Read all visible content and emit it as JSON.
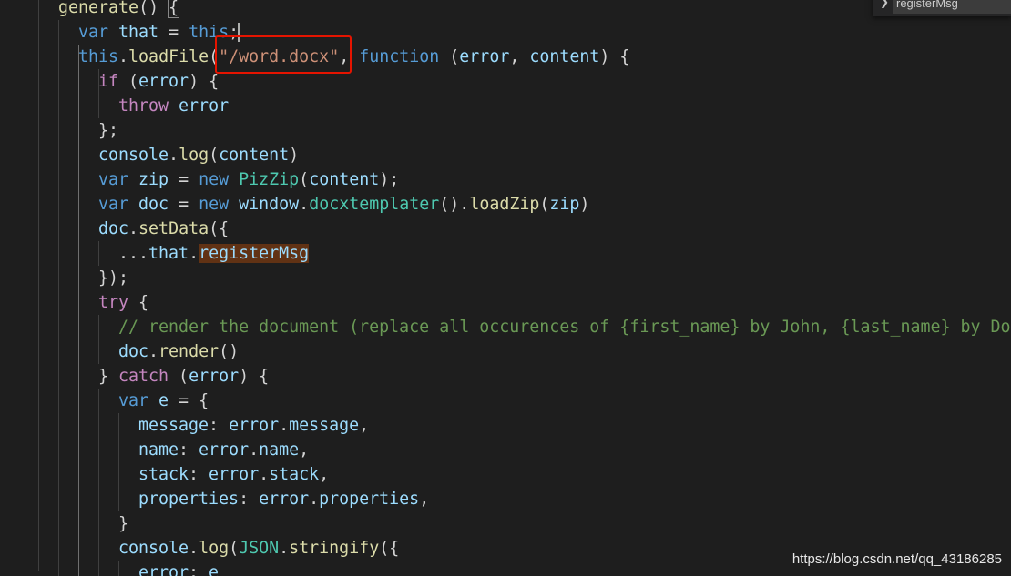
{
  "code_lines": [
    [
      {
        "c": "f",
        "t": "generate"
      },
      {
        "c": "p",
        "t": "() "
      },
      {
        "c": "p bm",
        "t": "{"
      }
    ],
    [
      {
        "c": "k",
        "t": "var "
      },
      {
        "c": "v",
        "t": "that"
      },
      {
        "c": "p",
        "t": " = "
      },
      {
        "c": "k",
        "t": "this"
      },
      {
        "c": "p",
        "t": ";"
      }
    ],
    [
      {
        "c": "k",
        "t": "this"
      },
      {
        "c": "p",
        "t": "."
      },
      {
        "c": "f",
        "t": "loadFile"
      },
      {
        "c": "p",
        "t": "("
      },
      {
        "c": "s",
        "t": "\"/word.docx\""
      },
      {
        "c": "p",
        "t": ", "
      },
      {
        "c": "k",
        "t": "function"
      },
      {
        "c": "p",
        "t": " ("
      },
      {
        "c": "v",
        "t": "error"
      },
      {
        "c": "p",
        "t": ", "
      },
      {
        "c": "v",
        "t": "content"
      },
      {
        "c": "p",
        "t": ") {"
      }
    ],
    [
      {
        "c": "c",
        "t": "if"
      },
      {
        "c": "p",
        "t": " ("
      },
      {
        "c": "v",
        "t": "error"
      },
      {
        "c": "p",
        "t": ") {"
      }
    ],
    [
      {
        "c": "c",
        "t": "throw "
      },
      {
        "c": "v",
        "t": "error"
      }
    ],
    [
      {
        "c": "p",
        "t": "};"
      }
    ],
    [
      {
        "c": "v",
        "t": "console"
      },
      {
        "c": "p",
        "t": "."
      },
      {
        "c": "f",
        "t": "log"
      },
      {
        "c": "p",
        "t": "("
      },
      {
        "c": "v",
        "t": "content"
      },
      {
        "c": "p",
        "t": ")"
      }
    ],
    [
      {
        "c": "k",
        "t": "var "
      },
      {
        "c": "v",
        "t": "zip"
      },
      {
        "c": "p",
        "t": " = "
      },
      {
        "c": "k",
        "t": "new "
      },
      {
        "c": "t",
        "t": "PizZip"
      },
      {
        "c": "p",
        "t": "("
      },
      {
        "c": "v",
        "t": "content"
      },
      {
        "c": "p",
        "t": ");"
      }
    ],
    [
      {
        "c": "k",
        "t": "var "
      },
      {
        "c": "v",
        "t": "doc"
      },
      {
        "c": "p",
        "t": " = "
      },
      {
        "c": "k",
        "t": "new "
      },
      {
        "c": "v",
        "t": "window"
      },
      {
        "c": "p",
        "t": "."
      },
      {
        "c": "t",
        "t": "docxtemplater"
      },
      {
        "c": "p",
        "t": "()."
      },
      {
        "c": "f",
        "t": "loadZip"
      },
      {
        "c": "p",
        "t": "("
      },
      {
        "c": "v",
        "t": "zip"
      },
      {
        "c": "p",
        "t": ")"
      }
    ],
    [
      {
        "c": "v",
        "t": "doc"
      },
      {
        "c": "p",
        "t": "."
      },
      {
        "c": "f",
        "t": "setData"
      },
      {
        "c": "p",
        "t": "({"
      }
    ],
    [
      {
        "c": "p",
        "t": "..."
      },
      {
        "c": "v",
        "t": "that"
      },
      {
        "c": "p",
        "t": "."
      },
      {
        "c": "v hl",
        "t": "registerMsg"
      }
    ],
    [
      {
        "c": "p",
        "t": "});"
      }
    ],
    [
      {
        "c": "c",
        "t": "try"
      },
      {
        "c": "p",
        "t": " {"
      }
    ],
    [
      {
        "c": "m",
        "t": "// render the document (replace all occurences of {first_name} by John, {last_name} by Doe, ...)"
      }
    ],
    [
      {
        "c": "v",
        "t": "doc"
      },
      {
        "c": "p",
        "t": "."
      },
      {
        "c": "f",
        "t": "render"
      },
      {
        "c": "p",
        "t": "()"
      }
    ],
    [
      {
        "c": "p",
        "t": "} "
      },
      {
        "c": "c",
        "t": "catch"
      },
      {
        "c": "p",
        "t": " ("
      },
      {
        "c": "v",
        "t": "error"
      },
      {
        "c": "p",
        "t": ") {"
      }
    ],
    [
      {
        "c": "k",
        "t": "var "
      },
      {
        "c": "v",
        "t": "e"
      },
      {
        "c": "p",
        "t": " = {"
      }
    ],
    [
      {
        "c": "v",
        "t": "message"
      },
      {
        "c": "p",
        "t": ": "
      },
      {
        "c": "v",
        "t": "error"
      },
      {
        "c": "p",
        "t": "."
      },
      {
        "c": "v",
        "t": "message"
      },
      {
        "c": "p",
        "t": ","
      }
    ],
    [
      {
        "c": "v",
        "t": "name"
      },
      {
        "c": "p",
        "t": ": "
      },
      {
        "c": "v",
        "t": "error"
      },
      {
        "c": "p",
        "t": "."
      },
      {
        "c": "v",
        "t": "name"
      },
      {
        "c": "p",
        "t": ","
      }
    ],
    [
      {
        "c": "v",
        "t": "stack"
      },
      {
        "c": "p",
        "t": ": "
      },
      {
        "c": "v",
        "t": "error"
      },
      {
        "c": "p",
        "t": "."
      },
      {
        "c": "v",
        "t": "stack"
      },
      {
        "c": "p",
        "t": ","
      }
    ],
    [
      {
        "c": "v",
        "t": "properties"
      },
      {
        "c": "p",
        "t": ": "
      },
      {
        "c": "v",
        "t": "error"
      },
      {
        "c": "p",
        "t": "."
      },
      {
        "c": "v",
        "t": "properties"
      },
      {
        "c": "p",
        "t": ","
      }
    ],
    [
      {
        "c": "p",
        "t": "}"
      }
    ],
    [
      {
        "c": "v",
        "t": "console"
      },
      {
        "c": "p",
        "t": "."
      },
      {
        "c": "f",
        "t": "log"
      },
      {
        "c": "p",
        "t": "("
      },
      {
        "c": "t",
        "t": "JSON"
      },
      {
        "c": "p",
        "t": "."
      },
      {
        "c": "f",
        "t": "stringify"
      },
      {
        "c": "p",
        "t": "({"
      }
    ],
    [
      {
        "c": "v",
        "t": "error"
      },
      {
        "c": "p",
        "t": ": "
      },
      {
        "c": "v",
        "t": "e"
      }
    ]
  ],
  "find_widget": {
    "query": "registerMsg",
    "toggle_icon": "chevron-right-icon"
  },
  "watermark": "https://blog.csdn.net/qq_43186285",
  "colors": {
    "background": "#1e1e1e",
    "keyword": "#569cd6",
    "control": "#c586c0",
    "function": "#dcdcaa",
    "variable": "#9cdcfe",
    "type": "#4ec9b0",
    "string": "#ce9178",
    "comment": "#6a9955",
    "annotation_box": "#e51400",
    "find_match": "#613214"
  }
}
